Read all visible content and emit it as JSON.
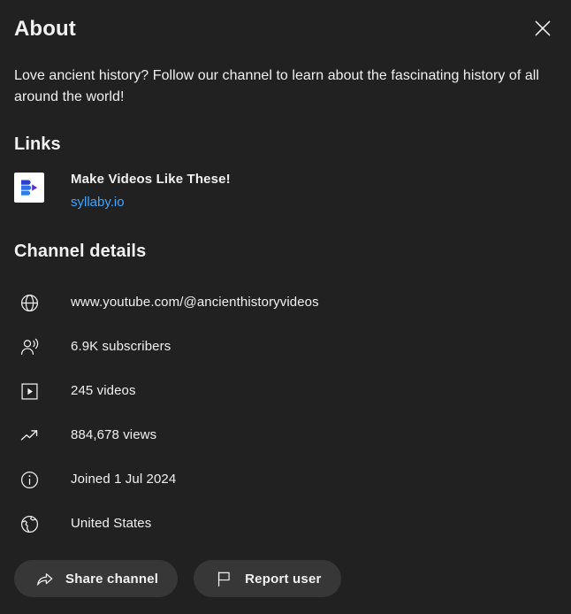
{
  "dialog": {
    "title": "About",
    "close_icon": "close-icon",
    "description": "Love ancient history? Follow our channel to learn about the fascinating history of all around the world!"
  },
  "links_section": {
    "heading": "Links",
    "items": [
      {
        "favicon": "syllaby-favicon-icon",
        "title": "Make Videos Like These!",
        "url": "syllaby.io"
      }
    ]
  },
  "channel_details": {
    "heading": "Channel details",
    "rows": [
      {
        "icon": "globe-icon",
        "text": "www.youtube.com/@ancienthistoryvideos"
      },
      {
        "icon": "subscribers-icon",
        "text": "6.9K subscribers"
      },
      {
        "icon": "videos-icon",
        "text": "245 videos"
      },
      {
        "icon": "trending-up-icon",
        "text": "884,678 views"
      },
      {
        "icon": "info-icon",
        "text": "Joined 1 Jul 2024"
      },
      {
        "icon": "earth-icon",
        "text": "United States"
      }
    ]
  },
  "actions": {
    "share": {
      "icon": "share-icon",
      "label": "Share channel"
    },
    "report": {
      "icon": "flag-icon",
      "label": "Report user"
    }
  },
  "colors": {
    "background": "#212121",
    "text_primary": "#f1f1f1",
    "link_blue": "#3ea6ff",
    "button_background": "#373737",
    "favicon_background": "#ffffff",
    "favicon_blue": "#2b4fd8",
    "favicon_purple": "#5a2fd0"
  }
}
